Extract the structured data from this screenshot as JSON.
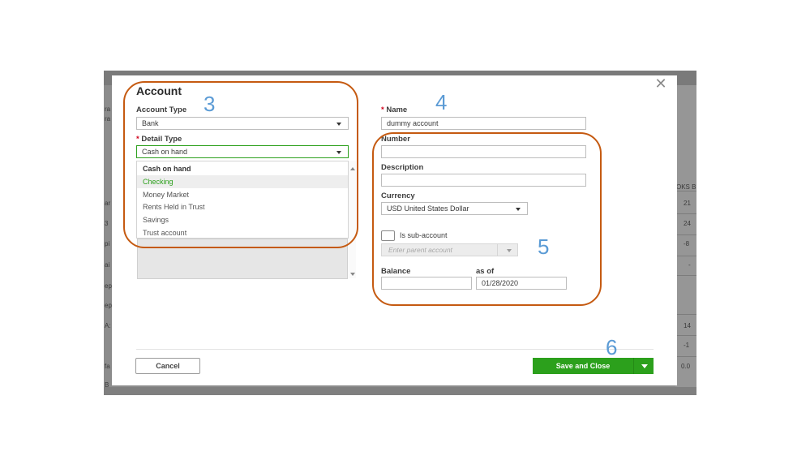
{
  "dialog": {
    "title": "Account",
    "close_glyph": "✕",
    "close_icon": "close-icon"
  },
  "left": {
    "account_type": {
      "label": "Account Type",
      "value": "Bank"
    },
    "detail_type": {
      "label": "Detail Type",
      "required": "*",
      "value": "Cash on hand",
      "options": [
        "Cash on hand",
        "Checking",
        "Money Market",
        "Rents Held in Trust",
        "Savings",
        "Trust account"
      ],
      "highlighted_option": "Checking"
    }
  },
  "right": {
    "name": {
      "label": "Name",
      "required": "*",
      "value": "dummy account"
    },
    "number": {
      "label": "Number",
      "value": ""
    },
    "description": {
      "label": "Description",
      "value": ""
    },
    "currency": {
      "label": "Currency",
      "value": "USD United States Dollar"
    },
    "sub_account": {
      "label": "Is sub-account",
      "checked": false,
      "parent_placeholder": "Enter parent account"
    },
    "balance": {
      "label": "Balance",
      "value": ""
    },
    "as_of": {
      "label": "as of",
      "value": "01/28/2020"
    }
  },
  "footer": {
    "cancel_label": "Cancel",
    "save_label": "Save and Close"
  },
  "annotations": {
    "n3": "3",
    "n4": "4",
    "n5": "5",
    "n6": "6",
    "outline_color": "#c55a11",
    "number_color": "#5b9bd5"
  },
  "colors": {
    "accent": "#2ca01c",
    "required": "#d0021b"
  },
  "background": {
    "left_fragments": [
      "ra",
      "ra",
      "ar",
      "3",
      "pi",
      "ai",
      "ep",
      "ep",
      "A:",
      "fa",
      "B"
    ],
    "right_header": "OKS B",
    "right_values": [
      "21",
      "24",
      "-8",
      "-",
      "14",
      "-1",
      "0.0"
    ]
  }
}
